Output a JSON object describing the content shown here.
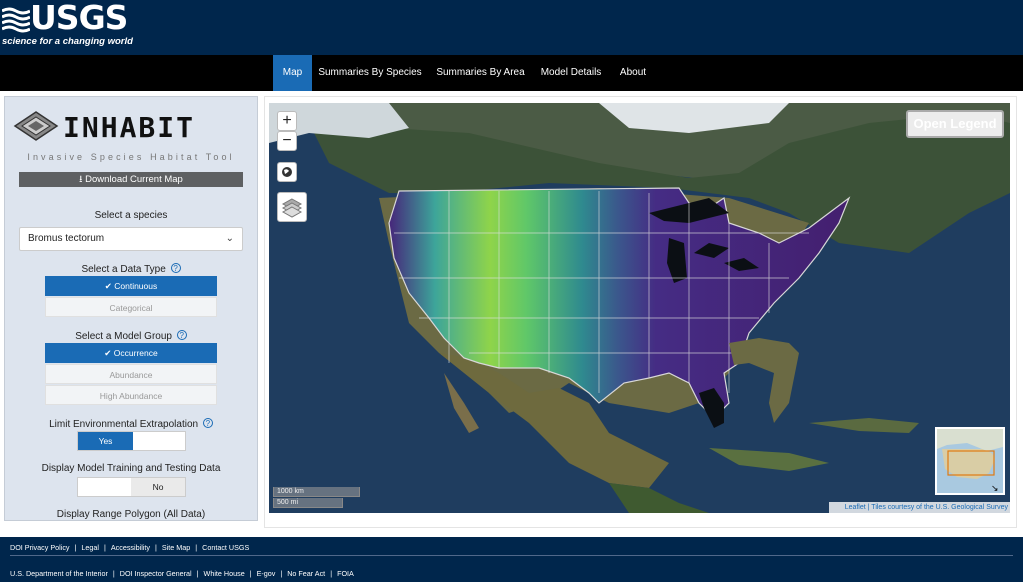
{
  "header": {
    "logo_text": "USGS",
    "tagline": "science for a changing world"
  },
  "nav": {
    "items": [
      {
        "label": "Map",
        "active": true
      },
      {
        "label": "Summaries By Species",
        "active": false
      },
      {
        "label": "Summaries By Area",
        "active": false
      },
      {
        "label": "Model Details",
        "active": false
      },
      {
        "label": "About",
        "active": false
      }
    ]
  },
  "sidebar": {
    "title": "INHABIT",
    "subtitle": "Invasive Species Habitat Tool",
    "download_label": "Download Current Map",
    "species_label": "Select a species",
    "species_value": "Bromus tectorum",
    "data_type_label": "Select a Data Type",
    "data_type_options": [
      "Continuous",
      "Categorical"
    ],
    "model_group_label": "Select a Model Group",
    "model_group_options": [
      "Occurrence",
      "Abundance",
      "High Abundance"
    ],
    "extrapolation_label": "Limit Environmental Extrapolation",
    "extrapolation_value": "Yes",
    "training_label": "Display Model Training and Testing Data",
    "training_value": "No",
    "range_label": "Display Range Polygon (All Data)"
  },
  "map": {
    "zoom_in": "+",
    "zoom_out": "−",
    "legend_button": "Open Legend",
    "scale_km": "1000 km",
    "scale_mi": "500 mi",
    "attribution_link": "Leaflet",
    "attribution_text": " | Tiles courtesy of the ",
    "attribution_source": "U.S. Geological Survey"
  },
  "footer": {
    "row1": [
      "DOI Privacy Policy",
      "Legal",
      "Accessibility",
      "Site Map",
      "Contact USGS"
    ],
    "row2": [
      "U.S. Department of the Interior",
      "DOI Inspector General",
      "White House",
      "E-gov",
      "No Fear Act",
      "FOIA"
    ]
  },
  "colors": {
    "header_bg": "#00264c",
    "nav_bg": "#000000",
    "accent": "#1a6bb5",
    "sidebar_bg": "#dde4ee"
  }
}
